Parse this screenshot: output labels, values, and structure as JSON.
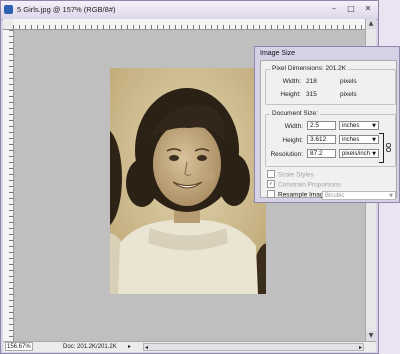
{
  "window": {
    "title": "5 Girls.jpg @ 157% (RGB/8#)"
  },
  "status": {
    "zoom": "156.67%",
    "doc": "Doc: 201.2K/201.2K"
  },
  "dialog": {
    "title": "Image Size",
    "pixel_dimensions": {
      "legend": "Pixel Dimensions: 201.2K",
      "width_label": "Width:",
      "width_value": "218",
      "width_unit": "pixels",
      "height_label": "Height:",
      "height_value": "315",
      "height_unit": "pixels"
    },
    "document_size": {
      "legend": "Document Size:",
      "width_label": "Width:",
      "width_value": "2.5",
      "width_unit": "inches",
      "height_label": "Height:",
      "height_value": "3.612",
      "height_unit": "inches",
      "resolution_label": "Resolution:",
      "resolution_value": "87.2",
      "resolution_unit": "pixels/inch"
    },
    "scale_styles": {
      "label": "Scale Styles",
      "checked": false
    },
    "constrain": {
      "label": "Constrain Proportions",
      "checked": true
    },
    "resample": {
      "label": "Resample Image:",
      "checked": false,
      "method": "Bicubic"
    }
  }
}
